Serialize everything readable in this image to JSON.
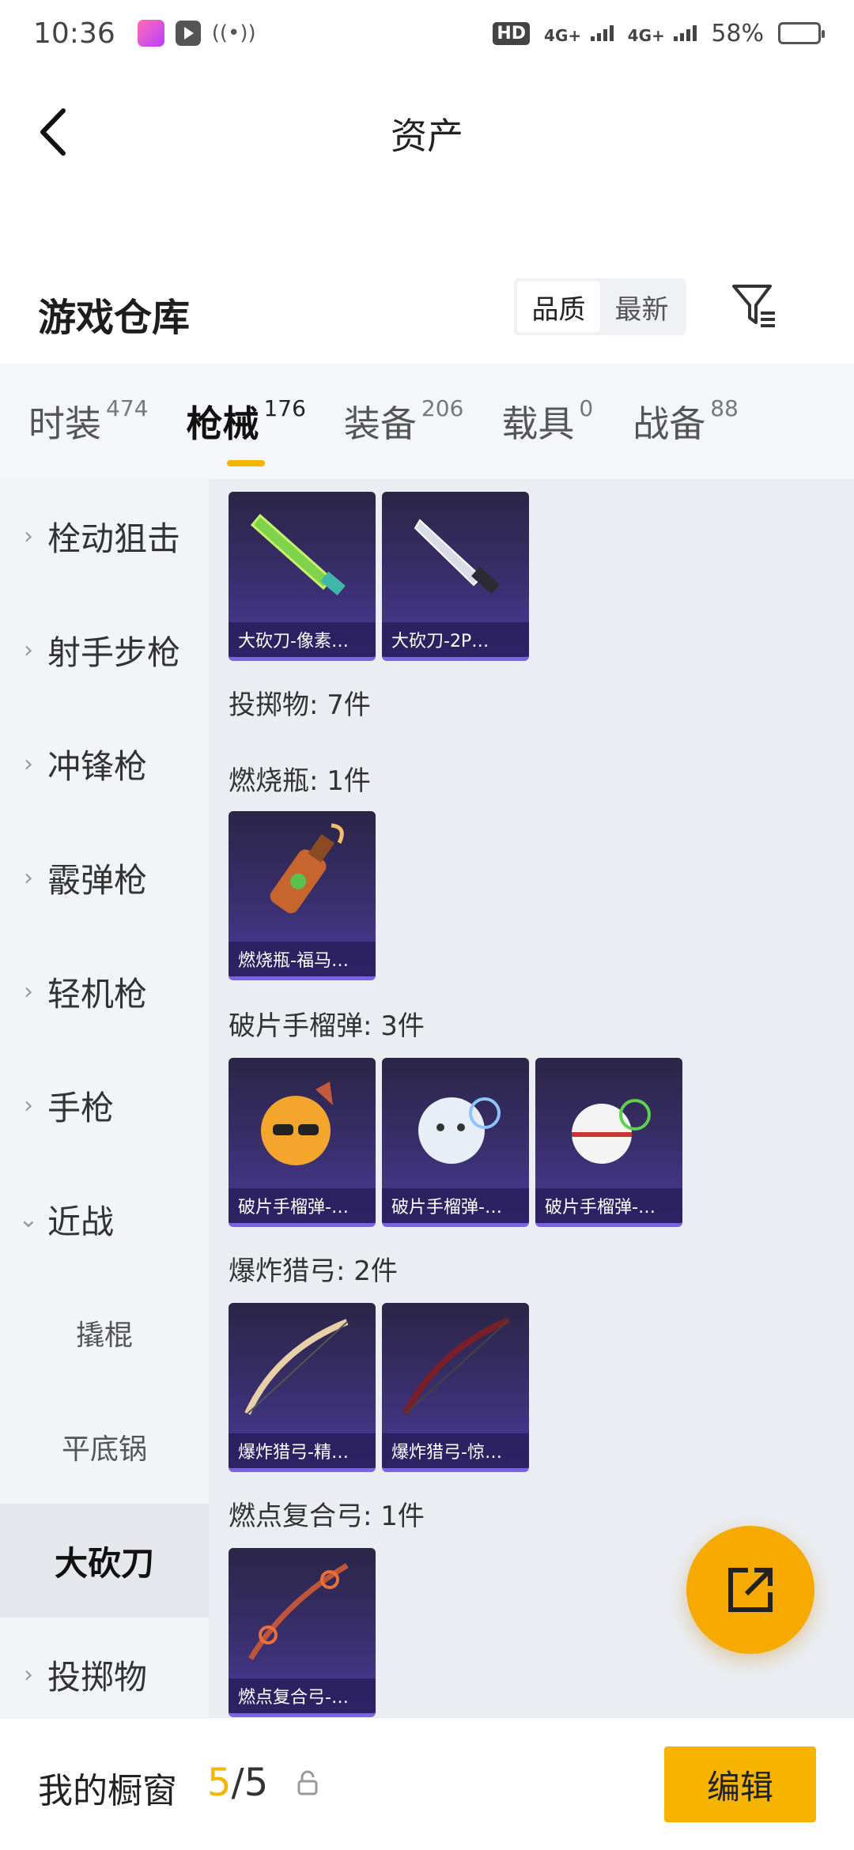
{
  "status": {
    "time": "10:36",
    "network1": "4G+",
    "network2": "4G+",
    "battery": "58%",
    "battery_level": 0.58,
    "hd_badge": "HD"
  },
  "header": {
    "title": "资产"
  },
  "section": {
    "title": "游戏仓库",
    "sort_options": [
      "品质",
      "最新"
    ],
    "sort_active": "品质"
  },
  "tabs": [
    {
      "label": "时装",
      "count": "474"
    },
    {
      "label": "枪械",
      "count": "176",
      "active": true
    },
    {
      "label": "装备",
      "count": "206"
    },
    {
      "label": "载具",
      "count": "0"
    },
    {
      "label": "战备",
      "count": "88"
    }
  ],
  "sidebar": {
    "items": [
      {
        "label": "栓动狙击"
      },
      {
        "label": "射手步枪"
      },
      {
        "label": "冲锋枪"
      },
      {
        "label": "霰弹枪"
      },
      {
        "label": "轻机枪"
      },
      {
        "label": "手枪"
      },
      {
        "label": "近战"
      },
      {
        "label": "撬棍"
      },
      {
        "label": "平底锅"
      },
      {
        "label": "大砍刀"
      },
      {
        "label": "投掷物"
      }
    ],
    "selected": "大砍刀"
  },
  "content": {
    "machete_cards": [
      "大砍刀-像素…",
      "大砍刀-2P…"
    ],
    "throwables_label": "投掷物: 7件",
    "molotov_label": "燃烧瓶: 1件",
    "molotov_cards": [
      "燃烧瓶-福马…"
    ],
    "grenade_label": "破片手榴弹: 3件",
    "grenade_cards": [
      "破片手榴弹-…",
      "破片手榴弹-…",
      "破片手榴弹-…"
    ],
    "bow_label": "爆炸猎弓: 2件",
    "bow_cards": [
      "爆炸猎弓-精…",
      "爆炸猎弓-惊…"
    ],
    "compound_label": "燃点复合弓: 1件",
    "compound_cards": [
      "燃点复合弓-…"
    ]
  },
  "bottom": {
    "showcase_label": "我的橱窗",
    "showcase_current": "5",
    "showcase_sep": "/",
    "showcase_total": "5",
    "edit_label": "编辑"
  },
  "colors": {
    "accent": "#f3b500",
    "card_bg": "#3a2f6e"
  }
}
